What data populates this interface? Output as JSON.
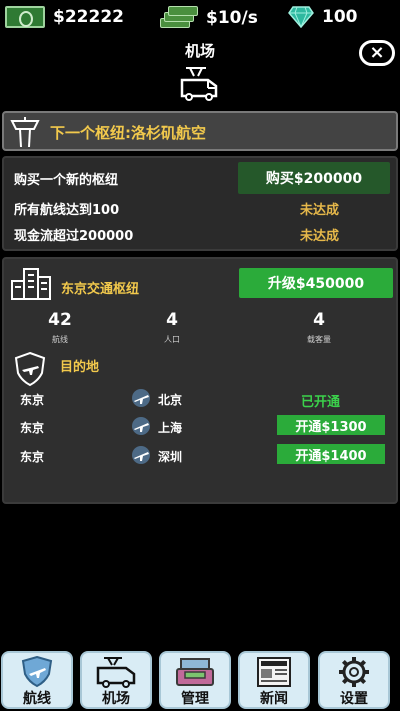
{
  "topbar": {
    "money": "$22222",
    "rate": "$10/s",
    "gems": "100"
  },
  "header": {
    "title": "机场",
    "close_symbol": "×",
    "icons": [
      "bus-icon",
      "close-icon"
    ]
  },
  "next_hub": {
    "label": "下一个枢纽:洛杉矶航空",
    "icon": "control-tower-icon"
  },
  "requirements": {
    "buy_button": "购买$200000",
    "items": [
      {
        "text": "购买一个新的枢纽"
      },
      {
        "text": "所有航线达到100",
        "status": "未达成"
      },
      {
        "text": "现金流超过200000",
        "status": "未达成"
      }
    ]
  },
  "hub": {
    "name": "东京交通枢纽",
    "icon": "city-buildings-icon",
    "upgrade_button": "升级$450000",
    "metrics": [
      {
        "value": "42",
        "label": "航线"
      },
      {
        "value": "4",
        "label": "人口"
      },
      {
        "value": "4",
        "label": "载客量"
      }
    ],
    "destinations_title": "目的地",
    "routes": [
      {
        "from": "东京",
        "to": "北京",
        "state": "已开通"
      },
      {
        "from": "东京",
        "to": "上海",
        "button": "开通$1300"
      },
      {
        "from": "东京",
        "to": "深圳",
        "button": "开通$1400"
      }
    ]
  },
  "nav": [
    {
      "label": "航线",
      "icon": "plane-shield-icon"
    },
    {
      "label": "机场",
      "icon": "bus-icon"
    },
    {
      "label": "管理",
      "icon": "cash-register-icon"
    },
    {
      "label": "新闻",
      "icon": "newspaper-icon"
    },
    {
      "label": "设置",
      "icon": "gear-icon"
    }
  ],
  "colors": {
    "accent_yellow": "#f2c94c",
    "button_green": "#2bab3a",
    "button_dark_green": "#25582a",
    "status_orange": "#e6b84a",
    "opened_green": "#3bd14b"
  }
}
